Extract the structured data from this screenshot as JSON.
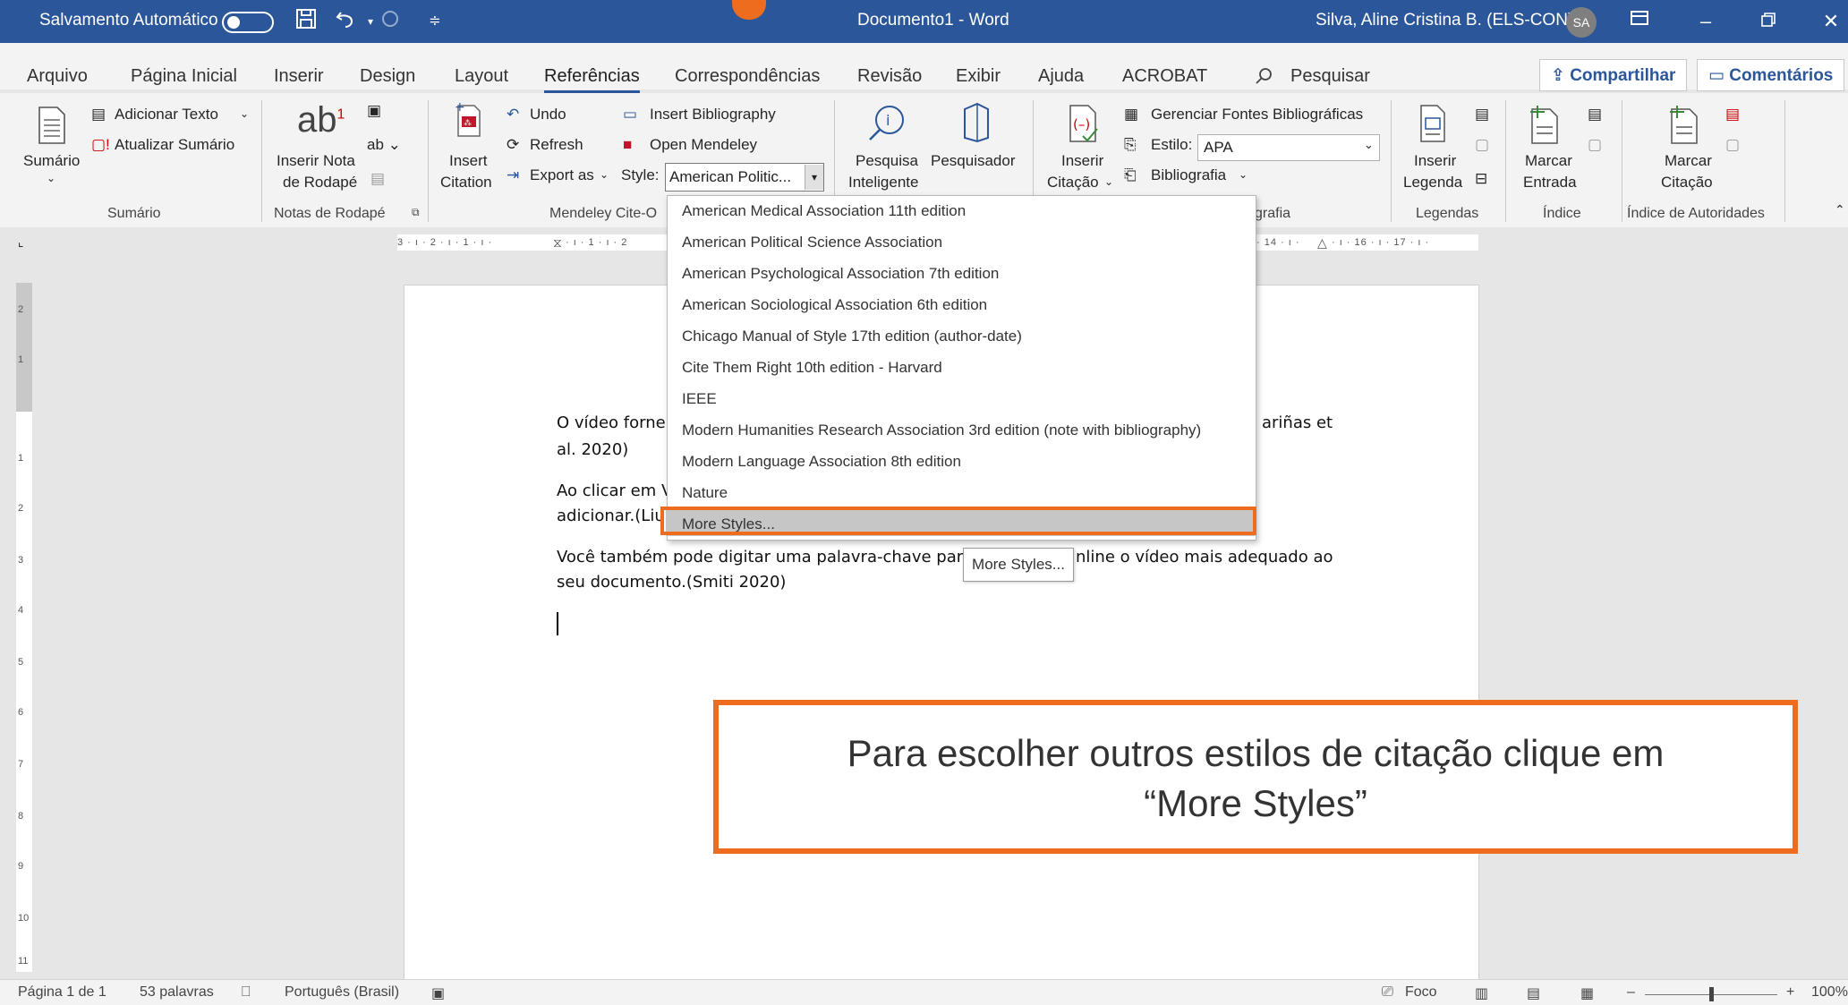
{
  "titlebar": {
    "autosave_label": "Salvamento Automático",
    "doc_title": "Documento1  -  Word",
    "user_name": "Silva, Aline Cristina B. (ELS-CON)",
    "user_initials": "SA"
  },
  "tabs": {
    "items": [
      "Arquivo",
      "Página Inicial",
      "Inserir",
      "Design",
      "Layout",
      "Referências",
      "Correspondências",
      "Revisão",
      "Exibir",
      "Ajuda",
      "ACROBAT"
    ],
    "search": "Pesquisar",
    "share": "Compartilhar",
    "comments": "Comentários"
  },
  "ribbon": {
    "sumario": {
      "btn": "Sumário",
      "add_text": "Adicionar Texto",
      "update": "Atualizar Sumário",
      "group": "Sumário"
    },
    "footnotes": {
      "insert_line1": "Inserir Nota",
      "insert_line2": "de Rodapé",
      "group": "Notas de Rodapé"
    },
    "mendeley": {
      "insert_line1": "Insert",
      "insert_line2": "Citation",
      "undo": "Undo",
      "refresh": "Refresh",
      "export": "Export as",
      "insert_bib": "Insert Bibliography",
      "open": "Open Mendeley",
      "style_label": "Style:",
      "style_value": "American Politic...",
      "group": "Mendeley Cite-O"
    },
    "research": {
      "smart_line1": "Pesquisa",
      "smart_line2": "Inteligente",
      "researcher": "Pesquisador"
    },
    "citations": {
      "insert_line1": "Inserir",
      "insert_line2": "Citação",
      "manage": "Gerenciar Fontes Bibliográficas",
      "style_label": "Estilo:",
      "style_value": "APA",
      "bibliography": "Bibliografia",
      "group": "grafia"
    },
    "captions": {
      "insert_line1": "Inserir",
      "insert_line2": "Legenda",
      "group": "Legendas"
    },
    "index": {
      "mark_line1": "Marcar",
      "mark_line2": "Entrada",
      "group": "Índice"
    },
    "authorities": {
      "mark_line1": "Marcar",
      "mark_line2": "Citação",
      "group": "Índice de Autoridades"
    }
  },
  "ruler": {
    "left_text": "3 · ı · 2 · ı · 1 · ı ·",
    "mid_text": "· ı · 1 · ı · 2",
    "right_text": "· 14 · ı · ",
    "right_text2": "· ı · 16 · ı · 17 · ı ·",
    "vertical_numbers": [
      "2",
      "1",
      "1",
      "2",
      "3",
      "4",
      "5",
      "6",
      "7",
      "8",
      "9",
      "10",
      "11"
    ]
  },
  "document": {
    "p1_a": "O vídeo forne",
    "p1_b": "ariñas et",
    "p1_c": "al. 2020)",
    "p2_a": "Ao clicar em V",
    "p2_b": "adicionar.(Liu",
    "p3_a": "Você também pode digitar uma palavra-chave par",
    "p3_b": "nline o vídeo mais adequado ao",
    "p3_c": "seu documento.(Smiti 2020)"
  },
  "dropdown": {
    "items": [
      "American Medical Association 11th edition",
      "American Political Science Association",
      "American Psychological Association 7th edition",
      "American Sociological Association 6th edition",
      "Chicago Manual of Style 17th edition (author-date)",
      "Cite Them Right 10th edition - Harvard",
      "IEEE",
      "Modern Humanities Research Association 3rd edition (note with bibliography)",
      "Modern Language Association 8th edition",
      "Nature",
      "More Styles..."
    ],
    "tooltip": "More Styles..."
  },
  "callout": {
    "line1": "Para escolher outros estilos de citação clique em",
    "line2": "“More Styles”"
  },
  "statusbar": {
    "page": "Página 1 de 1",
    "words": "53 palavras",
    "language": "Português (Brasil)",
    "focus": "Foco",
    "zoom_minus": "–",
    "zoom_plus": "+",
    "zoom": "100%"
  },
  "colors": {
    "word_blue": "#2b579a",
    "highlight_orange": "#ed6c1e"
  }
}
